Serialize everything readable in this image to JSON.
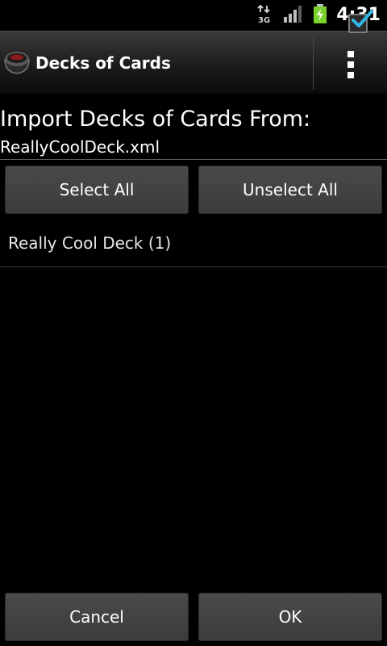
{
  "status_bar": {
    "time": "4:31",
    "network": "3G",
    "icons": [
      "3g-data-icon",
      "signal-strength-icon",
      "battery-charging-icon"
    ]
  },
  "action_bar": {
    "app_icon": "deck-box-icon",
    "title": "Decks of Cards",
    "overflow_icon": "overflow-menu-icon"
  },
  "content": {
    "heading": "Import Decks of Cards From:",
    "file_name": "ReallyCoolDeck.xml",
    "select_all_label": "Select All",
    "unselect_all_label": "Unselect All",
    "decks": [
      {
        "label": "Really Cool Deck (1)",
        "checked": true
      }
    ]
  },
  "footer": {
    "cancel_label": "Cancel",
    "ok_label": "OK"
  },
  "colors": {
    "background": "#000000",
    "accent_check": "#33b5e5",
    "battery_green": "#7ad32b",
    "button_bg": "#434343"
  }
}
